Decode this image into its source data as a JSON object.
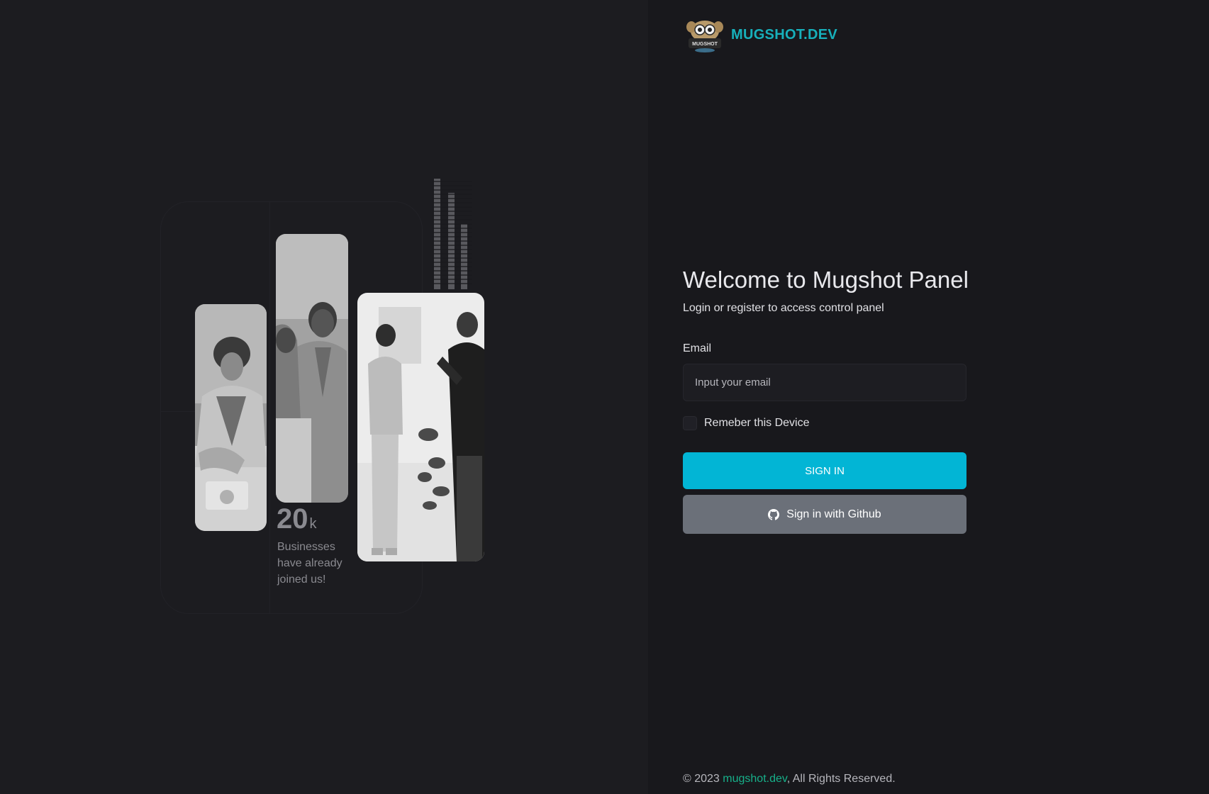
{
  "brand": {
    "name": "MUGSHOT.DEV",
    "logo_icon": "mugshot-logo-icon",
    "logo_text": "MUGSHOT"
  },
  "stats": {
    "number": "20",
    "unit": "k",
    "text": "Businesses have already joined us!"
  },
  "login": {
    "title": "Welcome to Mugshot Panel",
    "subtitle": "Login or register to access control panel",
    "email_label": "Email",
    "email_placeholder": "Input your email",
    "email_value": "",
    "remember_label": "Remeber this Device",
    "remember_checked": false,
    "signin_label": "SIGN IN",
    "github_label": "Sign in with Github",
    "github_icon": "github-icon"
  },
  "footer": {
    "copyright": "© 2023 ",
    "link_text": "mugshot.dev",
    "suffix": ", All Rights Reserved."
  },
  "colors": {
    "accent": "#02b5d5",
    "brand_teal": "#17b0bb",
    "link_green": "#17b08a",
    "github_button": "#6b7079",
    "left_bg": "#1c1c20",
    "right_bg": "#18181c"
  }
}
